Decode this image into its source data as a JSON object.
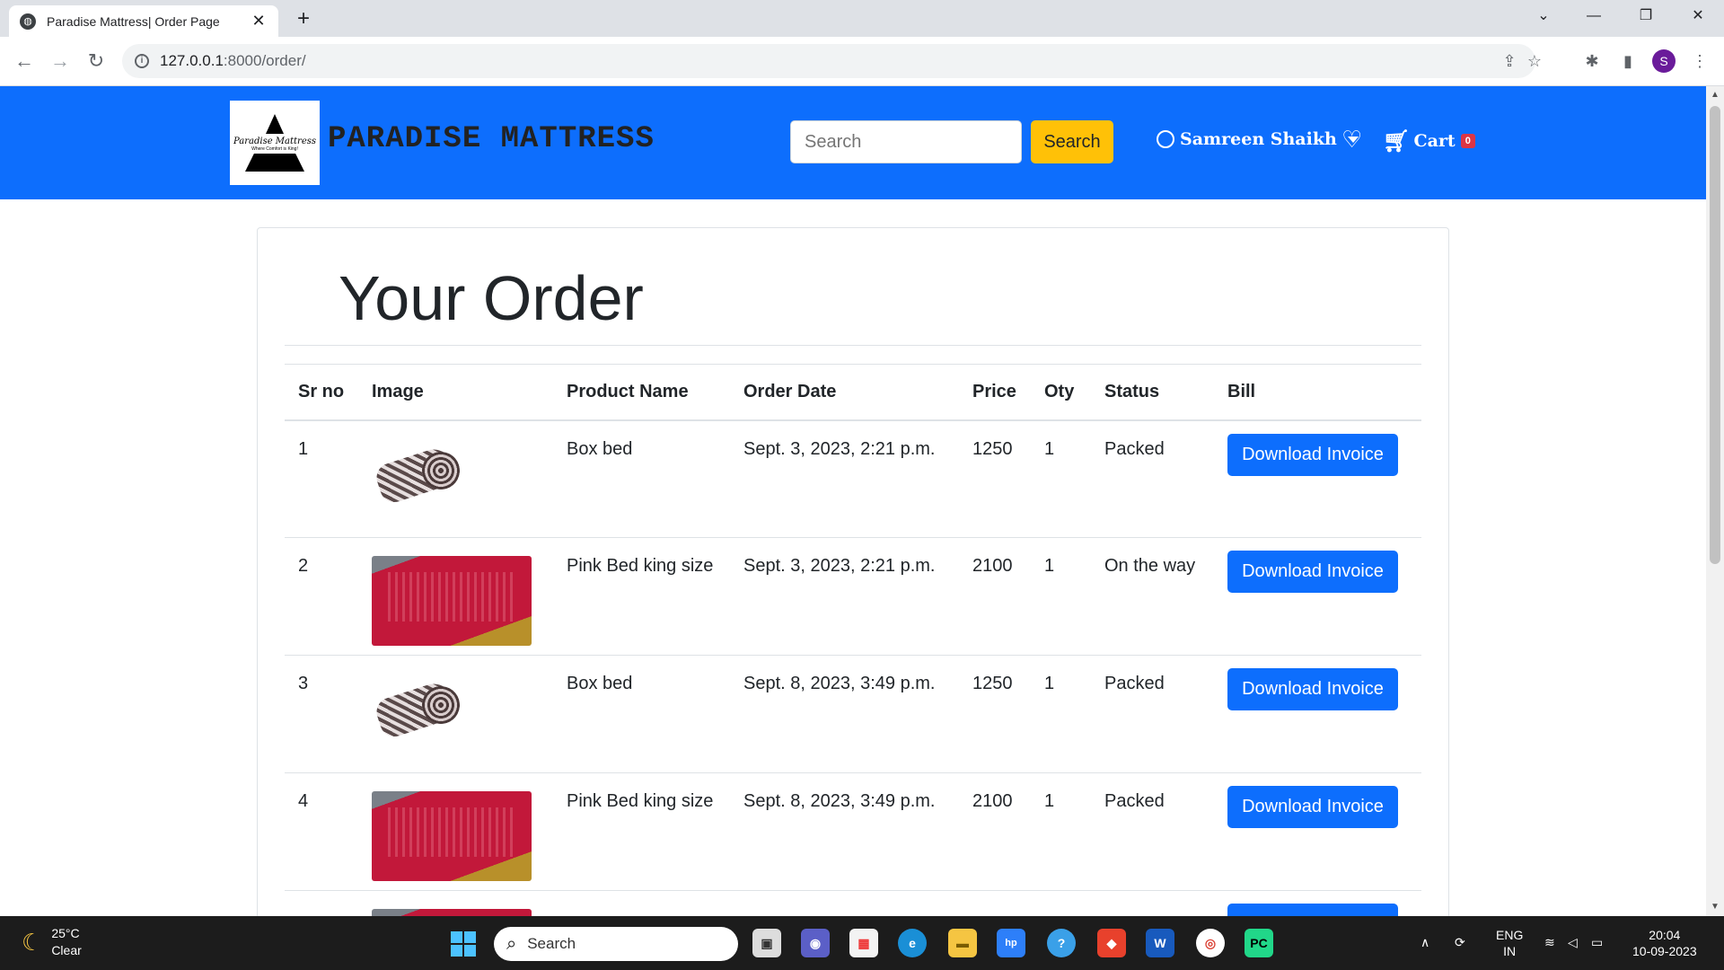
{
  "browser": {
    "tab_title": "Paradise Mattress| Order Page",
    "url_host": "127.0.0.1",
    "url_rest": ":8000/order/",
    "profile_initial": "S"
  },
  "site": {
    "logo_name": "Paradise Mattress",
    "logo_tagline": "Where Comfort is King!",
    "brand": "PARADISE MATTRESS",
    "search_placeholder": "Search",
    "search_button": "Search",
    "user_name": "Samreen Shaikh",
    "cart_label": "Cart",
    "cart_count": "0",
    "colors": {
      "navbar": "#0d6efd",
      "search_button": "#ffc107",
      "badge": "#dc3545"
    }
  },
  "page": {
    "title": "Your Order",
    "columns": [
      "Sr no",
      "Image",
      "Product Name",
      "Order Date",
      "Price",
      "Oty",
      "Status",
      "Bill"
    ],
    "orders": [
      {
        "sr": "1",
        "image": "rolled-mattress",
        "product": "Box bed",
        "date": "Sept. 3, 2023, 2:21 p.m.",
        "price": "1250",
        "qty": "1",
        "status": "Packed",
        "bill": "Download Invoice"
      },
      {
        "sr": "2",
        "image": "pink-bed",
        "product": "Pink Bed king size",
        "date": "Sept. 3, 2023, 2:21 p.m.",
        "price": "2100",
        "qty": "1",
        "status": "On the way",
        "bill": "Download Invoice"
      },
      {
        "sr": "3",
        "image": "rolled-mattress",
        "product": "Box bed",
        "date": "Sept. 8, 2023, 3:49 p.m.",
        "price": "1250",
        "qty": "1",
        "status": "Packed",
        "bill": "Download Invoice"
      },
      {
        "sr": "4",
        "image": "pink-bed",
        "product": "Pink Bed king size",
        "date": "Sept. 8, 2023, 3:49 p.m.",
        "price": "2100",
        "qty": "1",
        "status": "Packed",
        "bill": "Download Invoice"
      }
    ]
  },
  "taskbar": {
    "temperature": "25°C",
    "weather": "Clear",
    "search_label": "Search",
    "language": "ENG",
    "region": "IN",
    "time": "20:04",
    "date": "10-09-2023"
  }
}
